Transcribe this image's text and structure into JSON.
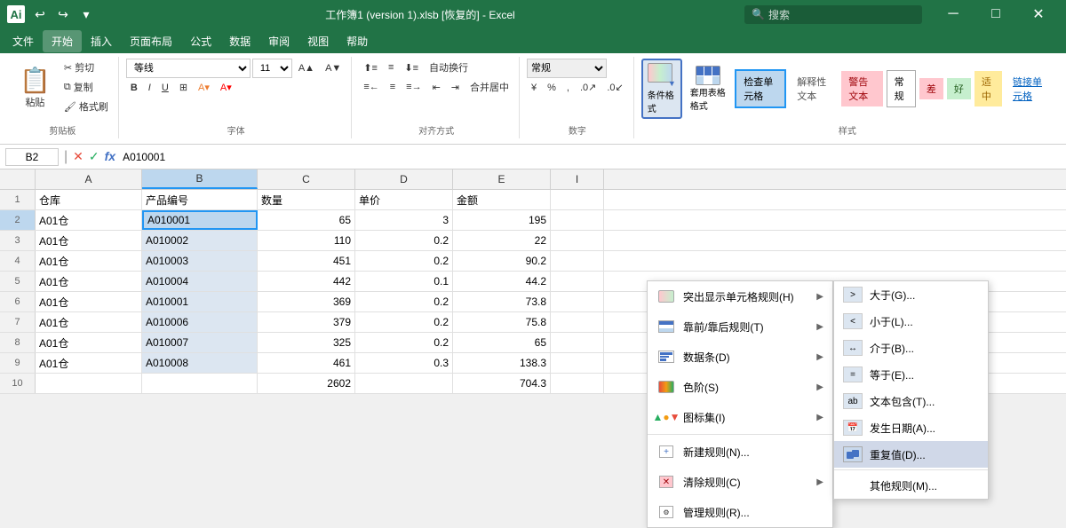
{
  "titleBar": {
    "icon": "Ai",
    "filename": "工作簿1 (version 1).xlsb [恢复的] - Excel",
    "undoBtn": "↩",
    "redoBtn": "↪",
    "searchPlaceholder": "搜索",
    "winMinimize": "─",
    "winRestore": "□",
    "winClose": "✕"
  },
  "menuBar": {
    "items": [
      "文件",
      "开始",
      "插入",
      "页面布局",
      "公式",
      "数据",
      "审阅",
      "视图",
      "帮助"
    ]
  },
  "ribbon": {
    "clipboard": {
      "label": "剪贴板",
      "paste": "粘贴",
      "cut": "剪切",
      "copy": "复制",
      "format_painter": "格式刷"
    },
    "font": {
      "label": "字体",
      "fontName": "等线",
      "fontSize": "11",
      "bold": "B",
      "italic": "I",
      "underline": "U",
      "border": "⊞",
      "fillColor": "A",
      "fontColor": "A"
    },
    "alignment": {
      "label": "对齐方式",
      "merge": "合并居中"
    },
    "number": {
      "label": "数字",
      "format": "常规"
    },
    "styles": {
      "label": "样式",
      "conditional": "条件格式",
      "asTable": "套用表格格式",
      "checkCell": "检查单元格",
      "explain": "解释性文本",
      "warn": "警告文本",
      "normal": "常规",
      "bad": "差",
      "good": "好",
      "medium": "适中",
      "link": "链接单元格"
    }
  },
  "formulaBar": {
    "cellRef": "B2",
    "cancelBtn": "✕",
    "confirmBtn": "✓",
    "funcBtn": "fx",
    "value": "A010001"
  },
  "columnHeaders": [
    "A",
    "B",
    "C",
    "D",
    "E",
    "I"
  ],
  "rows": [
    {
      "num": 1,
      "cells": [
        "仓库",
        "产品编号",
        "数量",
        "单价",
        "金额"
      ]
    },
    {
      "num": 2,
      "cells": [
        "A01仓",
        "A010001",
        "65",
        "3",
        "195"
      ]
    },
    {
      "num": 3,
      "cells": [
        "A01仓",
        "A010002",
        "110",
        "0.2",
        "22"
      ]
    },
    {
      "num": 4,
      "cells": [
        "A01仓",
        "A010003",
        "451",
        "0.2",
        "90.2"
      ]
    },
    {
      "num": 5,
      "cells": [
        "A01仓",
        "A010004",
        "442",
        "0.1",
        "44.2"
      ]
    },
    {
      "num": 6,
      "cells": [
        "A01仓",
        "A010001",
        "369",
        "0.2",
        "73.8"
      ]
    },
    {
      "num": 7,
      "cells": [
        "A01仓",
        "A010006",
        "379",
        "0.2",
        "75.8"
      ]
    },
    {
      "num": 8,
      "cells": [
        "A01仓",
        "A010007",
        "325",
        "0.2",
        "65"
      ]
    },
    {
      "num": 9,
      "cells": [
        "A01仓",
        "A010008",
        "461",
        "0.3",
        "138.3"
      ]
    },
    {
      "num": 10,
      "cells": [
        "",
        "",
        "2602",
        "",
        "704.3"
      ]
    }
  ],
  "mainMenu": {
    "items": [
      {
        "id": "highlight",
        "label": "突出显示单元格规则(H)",
        "hasSub": true
      },
      {
        "id": "topbottom",
        "label": "靠前/靠后规则(T)",
        "hasSub": true
      },
      {
        "id": "databar",
        "label": "数据条(D)",
        "hasSub": true
      },
      {
        "id": "colorscale",
        "label": "色阶(S)",
        "hasSub": true
      },
      {
        "id": "iconset",
        "label": "图标集(I)",
        "hasSub": true
      },
      {
        "id": "newrule",
        "label": "新建规则(N)...",
        "hasSub": false
      },
      {
        "id": "clearrule",
        "label": "清除规则(C)",
        "hasSub": true
      },
      {
        "id": "managerule",
        "label": "管理规则(R)...",
        "hasSub": false
      }
    ]
  },
  "subMenu": {
    "items": [
      {
        "id": "greater",
        "label": "大于(G)..."
      },
      {
        "id": "less",
        "label": "小于(L)..."
      },
      {
        "id": "between",
        "label": "介于(B)..."
      },
      {
        "id": "equal",
        "label": "等于(E)..."
      },
      {
        "id": "contains",
        "label": "文本包含(T)..."
      },
      {
        "id": "date",
        "label": "发生日期(A)..."
      },
      {
        "id": "duplicate",
        "label": "重复值(D)...",
        "active": true
      },
      {
        "id": "other",
        "label": "其他规则(M)..."
      }
    ]
  },
  "colors": {
    "excel_green": "#217346",
    "accent_blue": "#4472c4",
    "highlight_blue": "#bdd7ee",
    "selected_border": "#2196f3",
    "bad_bg": "#ffc7ce",
    "good_bg": "#c6efce",
    "medium_bg": "#ffeb9c"
  }
}
